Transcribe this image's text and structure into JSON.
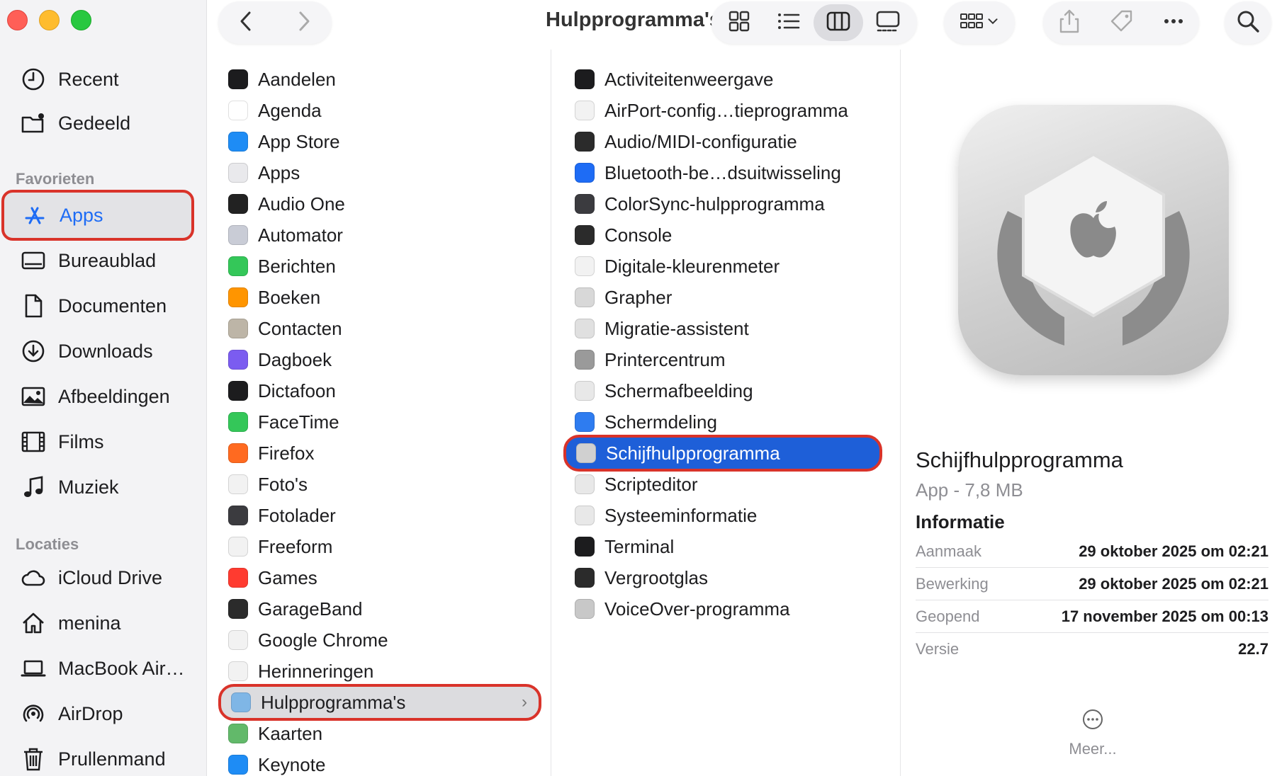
{
  "window": {
    "title": "Hulpprogramma's"
  },
  "sidebar": {
    "top_items": [
      {
        "label": "Recent",
        "icon": "clock-icon"
      },
      {
        "label": "Gedeeld",
        "icon": "shared-folder-icon"
      }
    ],
    "favorites_heading": "Favorieten",
    "favorites": [
      {
        "label": "Apps",
        "icon": "apps-icon",
        "selected": true
      },
      {
        "label": "Bureaublad",
        "icon": "desktop-icon"
      },
      {
        "label": "Documenten",
        "icon": "document-icon"
      },
      {
        "label": "Downloads",
        "icon": "download-icon"
      },
      {
        "label": "Afbeeldingen",
        "icon": "photo-icon"
      },
      {
        "label": "Films",
        "icon": "film-icon"
      },
      {
        "label": "Muziek",
        "icon": "music-icon"
      }
    ],
    "locations_heading": "Locaties",
    "locations": [
      {
        "label": "iCloud Drive",
        "icon": "cloud-icon"
      },
      {
        "label": "menina",
        "icon": "home-icon"
      },
      {
        "label": "MacBook Air…",
        "icon": "laptop-icon"
      },
      {
        "label": "AirDrop",
        "icon": "airdrop-icon"
      },
      {
        "label": "Prullenmand",
        "icon": "trash-icon"
      }
    ]
  },
  "toolbar": {
    "back": "back-chevron-icon",
    "forward": "forward-chevron-icon",
    "views": [
      "icon-view-icon",
      "list-view-icon",
      "column-view-icon",
      "gallery-view-icon"
    ],
    "active_view": "column-view-icon"
  },
  "column1": {
    "items": [
      {
        "label": "Aandelen",
        "color": "#1c1c1e"
      },
      {
        "label": "Agenda",
        "color": "#ffffff"
      },
      {
        "label": "App Store",
        "color": "#1e8cf5"
      },
      {
        "label": "Apps",
        "color": "#e9e9ec"
      },
      {
        "label": "Audio One",
        "color": "#222222"
      },
      {
        "label": "Automator",
        "color": "#c9ccd6"
      },
      {
        "label": "Berichten",
        "color": "#34c759"
      },
      {
        "label": "Boeken",
        "color": "#ff9500"
      },
      {
        "label": "Contacten",
        "color": "#bdb5a7"
      },
      {
        "label": "Dagboek",
        "color": "#7b5cf0"
      },
      {
        "label": "Dictafoon",
        "color": "#1c1c1e"
      },
      {
        "label": "FaceTime",
        "color": "#34c759"
      },
      {
        "label": "Firefox",
        "color": "#ff6a20"
      },
      {
        "label": "Foto's",
        "color": "#f2f2f2"
      },
      {
        "label": "Fotolader",
        "color": "#3b3b3f"
      },
      {
        "label": "Freeform",
        "color": "#f2f2f2"
      },
      {
        "label": "Games",
        "color": "#ff3b30"
      },
      {
        "label": "GarageBand",
        "color": "#2b2b2b"
      },
      {
        "label": "Google Chrome",
        "color": "#f2f2f2"
      },
      {
        "label": "Herinneringen",
        "color": "#f2f2f2"
      },
      {
        "label": "Hulpprogramma's",
        "color": "#7fb6e6",
        "selected": true
      },
      {
        "label": "Kaarten",
        "color": "#62b96a"
      },
      {
        "label": "Keynote",
        "color": "#1e8cf5"
      }
    ]
  },
  "column2": {
    "items": [
      {
        "label": "Activiteitenweergave",
        "color": "#1c1c1e"
      },
      {
        "label": "AirPort-config…tieprogramma",
        "color": "#f2f2f2"
      },
      {
        "label": "Audio/MIDI-configuratie",
        "color": "#2b2b2b"
      },
      {
        "label": "Bluetooth-be…dsuitwisseling",
        "color": "#1e6cf5"
      },
      {
        "label": "ColorSync-hulpprogramma",
        "color": "#3b3b3f"
      },
      {
        "label": "Console",
        "color": "#2b2b2b"
      },
      {
        "label": "Digitale-kleurenmeter",
        "color": "#f2f2f2"
      },
      {
        "label": "Grapher",
        "color": "#d8d8d8"
      },
      {
        "label": "Migratie-assistent",
        "color": "#e0e0e0"
      },
      {
        "label": "Printercentrum",
        "color": "#9a9a9a"
      },
      {
        "label": "Schermafbeelding",
        "color": "#e8e8e8"
      },
      {
        "label": "Schermdeling",
        "color": "#2e7cf0"
      },
      {
        "label": "Schijfhulpprogramma",
        "color": "#d0d0d0",
        "selected": true
      },
      {
        "label": "Scripteditor",
        "color": "#e8e8e8"
      },
      {
        "label": "Systeeminformatie",
        "color": "#e8e8e8"
      },
      {
        "label": "Terminal",
        "color": "#1c1c1e"
      },
      {
        "label": "Vergrootglas",
        "color": "#2b2b2b"
      },
      {
        "label": "VoiceOver-programma",
        "color": "#c8c8c8"
      }
    ]
  },
  "preview": {
    "name": "Schijfhulpprogramma",
    "subtitle": "App - 7,8 MB",
    "info_heading": "Informatie",
    "info": [
      {
        "key": "Aanmaak",
        "value": "29 oktober 2025 om 02:21"
      },
      {
        "key": "Bewerking",
        "value": "29 oktober 2025 om 02:21"
      },
      {
        "key": "Geopend",
        "value": "17 november 2025 om 00:13"
      },
      {
        "key": "Versie",
        "value": "22.7"
      }
    ],
    "more_label": "Meer..."
  },
  "colors": {
    "accent": "#1e6cf5",
    "selection_blue": "#1e5fd8",
    "highlight_border": "#d9332a"
  }
}
